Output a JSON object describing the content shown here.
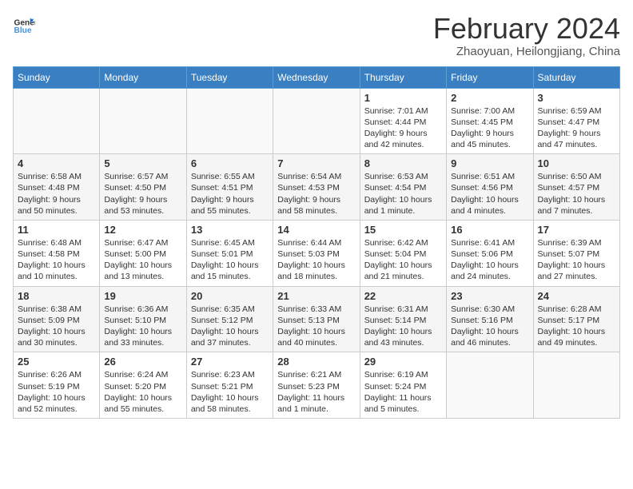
{
  "header": {
    "logo_general": "General",
    "logo_blue": "Blue",
    "main_title": "February 2024",
    "subtitle": "Zhaoyuan, Heilongjiang, China"
  },
  "days_of_week": [
    "Sunday",
    "Monday",
    "Tuesday",
    "Wednesday",
    "Thursday",
    "Friday",
    "Saturday"
  ],
  "weeks": [
    [
      {
        "day": "",
        "detail": ""
      },
      {
        "day": "",
        "detail": ""
      },
      {
        "day": "",
        "detail": ""
      },
      {
        "day": "",
        "detail": ""
      },
      {
        "day": "1",
        "detail": "Sunrise: 7:01 AM\nSunset: 4:44 PM\nDaylight: 9 hours\nand 42 minutes."
      },
      {
        "day": "2",
        "detail": "Sunrise: 7:00 AM\nSunset: 4:45 PM\nDaylight: 9 hours\nand 45 minutes."
      },
      {
        "day": "3",
        "detail": "Sunrise: 6:59 AM\nSunset: 4:47 PM\nDaylight: 9 hours\nand 47 minutes."
      }
    ],
    [
      {
        "day": "4",
        "detail": "Sunrise: 6:58 AM\nSunset: 4:48 PM\nDaylight: 9 hours\nand 50 minutes."
      },
      {
        "day": "5",
        "detail": "Sunrise: 6:57 AM\nSunset: 4:50 PM\nDaylight: 9 hours\nand 53 minutes."
      },
      {
        "day": "6",
        "detail": "Sunrise: 6:55 AM\nSunset: 4:51 PM\nDaylight: 9 hours\nand 55 minutes."
      },
      {
        "day": "7",
        "detail": "Sunrise: 6:54 AM\nSunset: 4:53 PM\nDaylight: 9 hours\nand 58 minutes."
      },
      {
        "day": "8",
        "detail": "Sunrise: 6:53 AM\nSunset: 4:54 PM\nDaylight: 10 hours\nand 1 minute."
      },
      {
        "day": "9",
        "detail": "Sunrise: 6:51 AM\nSunset: 4:56 PM\nDaylight: 10 hours\nand 4 minutes."
      },
      {
        "day": "10",
        "detail": "Sunrise: 6:50 AM\nSunset: 4:57 PM\nDaylight: 10 hours\nand 7 minutes."
      }
    ],
    [
      {
        "day": "11",
        "detail": "Sunrise: 6:48 AM\nSunset: 4:58 PM\nDaylight: 10 hours\nand 10 minutes."
      },
      {
        "day": "12",
        "detail": "Sunrise: 6:47 AM\nSunset: 5:00 PM\nDaylight: 10 hours\nand 13 minutes."
      },
      {
        "day": "13",
        "detail": "Sunrise: 6:45 AM\nSunset: 5:01 PM\nDaylight: 10 hours\nand 15 minutes."
      },
      {
        "day": "14",
        "detail": "Sunrise: 6:44 AM\nSunset: 5:03 PM\nDaylight: 10 hours\nand 18 minutes."
      },
      {
        "day": "15",
        "detail": "Sunrise: 6:42 AM\nSunset: 5:04 PM\nDaylight: 10 hours\nand 21 minutes."
      },
      {
        "day": "16",
        "detail": "Sunrise: 6:41 AM\nSunset: 5:06 PM\nDaylight: 10 hours\nand 24 minutes."
      },
      {
        "day": "17",
        "detail": "Sunrise: 6:39 AM\nSunset: 5:07 PM\nDaylight: 10 hours\nand 27 minutes."
      }
    ],
    [
      {
        "day": "18",
        "detail": "Sunrise: 6:38 AM\nSunset: 5:09 PM\nDaylight: 10 hours\nand 30 minutes."
      },
      {
        "day": "19",
        "detail": "Sunrise: 6:36 AM\nSunset: 5:10 PM\nDaylight: 10 hours\nand 33 minutes."
      },
      {
        "day": "20",
        "detail": "Sunrise: 6:35 AM\nSunset: 5:12 PM\nDaylight: 10 hours\nand 37 minutes."
      },
      {
        "day": "21",
        "detail": "Sunrise: 6:33 AM\nSunset: 5:13 PM\nDaylight: 10 hours\nand 40 minutes."
      },
      {
        "day": "22",
        "detail": "Sunrise: 6:31 AM\nSunset: 5:14 PM\nDaylight: 10 hours\nand 43 minutes."
      },
      {
        "day": "23",
        "detail": "Sunrise: 6:30 AM\nSunset: 5:16 PM\nDaylight: 10 hours\nand 46 minutes."
      },
      {
        "day": "24",
        "detail": "Sunrise: 6:28 AM\nSunset: 5:17 PM\nDaylight: 10 hours\nand 49 minutes."
      }
    ],
    [
      {
        "day": "25",
        "detail": "Sunrise: 6:26 AM\nSunset: 5:19 PM\nDaylight: 10 hours\nand 52 minutes."
      },
      {
        "day": "26",
        "detail": "Sunrise: 6:24 AM\nSunset: 5:20 PM\nDaylight: 10 hours\nand 55 minutes."
      },
      {
        "day": "27",
        "detail": "Sunrise: 6:23 AM\nSunset: 5:21 PM\nDaylight: 10 hours\nand 58 minutes."
      },
      {
        "day": "28",
        "detail": "Sunrise: 6:21 AM\nSunset: 5:23 PM\nDaylight: 11 hours\nand 1 minute."
      },
      {
        "day": "29",
        "detail": "Sunrise: 6:19 AM\nSunset: 5:24 PM\nDaylight: 11 hours\nand 5 minutes."
      },
      {
        "day": "",
        "detail": ""
      },
      {
        "day": "",
        "detail": ""
      }
    ]
  ]
}
